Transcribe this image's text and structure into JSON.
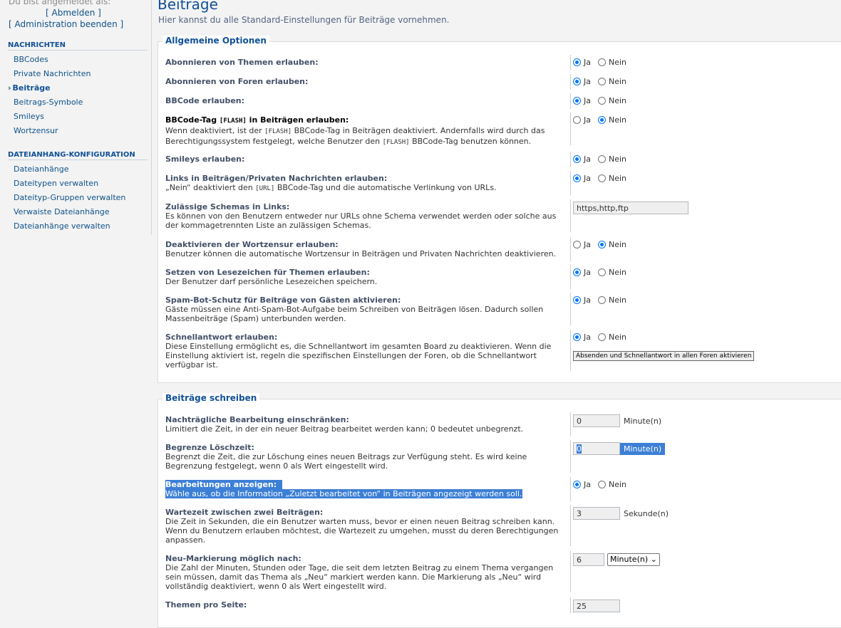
{
  "login": {
    "logged_in_as": "Du bist angemeldet als:",
    "logout": "[ Abmelden ]",
    "end_admin": "[ Administration beenden ]"
  },
  "sidebar": {
    "sections": [
      {
        "title": "NACHRICHTEN",
        "items": [
          "BBCodes",
          "Private Nachrichten",
          "Beiträge",
          "Beitrags-Symbole",
          "Smileys",
          "Wortzensur"
        ]
      },
      {
        "title": "DATEIANHANG-KONFIGURATION",
        "items": [
          "Dateianhänge",
          "Dateitypen verwalten",
          "Dateityp-Gruppen verwalten",
          "Verwaiste Dateianhänge",
          "Dateianhänge verwalten"
        ]
      }
    ],
    "active_item": "Beiträge"
  },
  "page": {
    "title": "Beiträge",
    "description": "Hier kannst du alle Standard-Einstellungen für Beiträge vornehmen."
  },
  "radio_labels": {
    "yes": "Ja",
    "no": "Nein"
  },
  "general": {
    "legend": "Allgemeine Optionen",
    "rows": [
      {
        "label": "Abonnieren von Themen erlauben:",
        "value": "yes"
      },
      {
        "label": "Abonnieren von Foren erlauben:",
        "value": "yes"
      },
      {
        "label": "BBCode erlauben:",
        "value": "yes"
      },
      {
        "label_a": "BBCode-Tag ",
        "label_code": "[FLASH]",
        "label_b": " in Beiträgen erlauben:",
        "exp_a": "Wenn deaktiviert, ist der ",
        "exp_code1": "[FLASH]",
        "exp_b": " BBCode-Tag in Beiträgen deaktiviert. Andernfalls wird durch das",
        "exp_c": "Berechtigungssystem festgelegt, welche Benutzer den ",
        "exp_code2": "[FLASH]",
        "exp_d": " BBCode-Tag benutzen können.",
        "value": "no"
      },
      {
        "label": "Smileys erlauben:",
        "value": "yes"
      },
      {
        "label": "Links in Beiträgen/Privaten Nachrichten erlauben:",
        "exp_a": "„Nein“ deaktiviert den ",
        "exp_code": "[URL]",
        "exp_b": " BBCode-Tag und die automatische Verlinkung von URLs.",
        "value": "yes"
      },
      {
        "label": "Zulässige Schemas in Links:",
        "exp1": "Es können von den Benutzern entweder nur URLs ohne Schema verwendet werden oder solche aus",
        "exp2": "der kommagetrennten Liste an zulässigen Schemas.",
        "input": "https,http,ftp"
      },
      {
        "label": "Deaktivieren der Wortzensur erlauben:",
        "exp1": "Benutzer können die automatische Wortzensur in Beiträgen und Privaten Nachrichten deaktivieren.",
        "value": "no"
      },
      {
        "label": "Setzen von Lesezeichen für Themen erlauben:",
        "exp1": "Der Benutzer darf persönliche Lesezeichen speichern.",
        "value": "yes"
      },
      {
        "label": "Spam-Bot-Schutz für Beiträge von Gästen aktivieren:",
        "exp1": "Gäste müssen eine Anti-Spam-Bot-Aufgabe beim Schreiben von Beiträgen lösen. Dadurch sollen",
        "exp2": "Massenbeiträge (Spam) unterbunden werden.",
        "value": "yes"
      },
      {
        "label": "Schnellantwort erlauben:",
        "exp1": "Diese Einstellung ermöglicht es, die Schnellantwort im gesamten Board zu deaktivieren. Wenn die",
        "exp2": "Einstellung aktiviert ist, regeln die spezifischen Einstellungen der Foren, ob die Schnellantwort",
        "exp3": "verfügbar ist.",
        "value": "yes",
        "button": "Absenden und Schnellantwort in allen Foren aktivieren"
      }
    ]
  },
  "writing": {
    "legend": "Beiträge schreiben",
    "rows": [
      {
        "label": "Nachträgliche Bearbeitung einschränken:",
        "exp1": "Limitiert die Zeit, in der ein neuer Beitrag bearbeitet werden kann; 0 bedeutet unbegrenzt.",
        "input": "0",
        "unit": "Minute(n)"
      },
      {
        "label": "Begrenze Löschzeit:",
        "exp1": "Begrenzt die Zeit, die zur Löschung eines neuen Beitrags zur Verfügung steht. Es wird keine",
        "exp2": "Begrenzung festgelegt, wenn 0 als Wert eingestellt wird.",
        "input": "0",
        "unit": "Minute(n)"
      },
      {
        "label": "Bearbeitungen anzeigen:",
        "exp1": "Wähle aus, ob die Information „Zuletzt bearbeitet von“ in Beiträgen angezeigt werden soll.",
        "value": "yes"
      },
      {
        "label": "Wartezeit zwischen zwei Beiträgen:",
        "exp1": "Die Zeit in Sekunden, die ein Benutzer warten muss, bevor er einen neuen Beitrag schreiben kann.",
        "exp2": "Wenn du Benutzern erlauben möchtest, die Wartezeit zu umgehen, musst du deren Berechtigungen",
        "exp3": "anpassen.",
        "input": "3",
        "unit": "Sekunde(n)"
      },
      {
        "label": "Neu-Markierung möglich nach:",
        "exp1": "Die Zahl der Minuten, Stunden oder Tage, die seit dem letzten Beitrag zu einem Thema vergangen",
        "exp2": "sein müssen, damit das Thema als „Neu“ markiert werden kann. Die Markierung als „Neu“ wird",
        "exp3": "vollständig deaktiviert, wenn 0 als Wert eingestellt wird.",
        "input": "6",
        "select": "Minute(n)"
      },
      {
        "label": "Themen pro Seite:",
        "input": "25"
      }
    ]
  }
}
